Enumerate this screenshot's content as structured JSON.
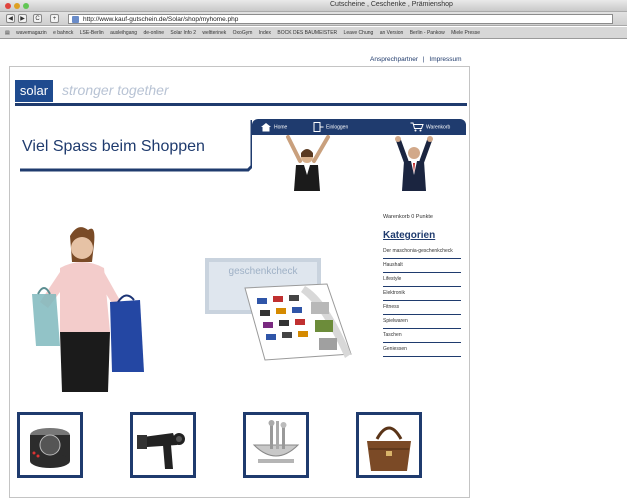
{
  "window": {
    "title": "Cutscheine , Ceschenke , Prämienshop"
  },
  "toolbar": {
    "back": "◀",
    "forward": "▶",
    "reload": "C",
    "add": "+",
    "url": "http://www.kauf-gutschein.de/Solar/shop/myhome.php"
  },
  "bookmarks": [
    "wavemagazin",
    "e bahnck",
    "LSE-Berlin",
    "ausleihgang",
    "de-online",
    "Solar Info 2",
    "weltterinek",
    "OxoGym",
    "Index",
    "BOCK DES BAUMEISTER",
    "Leave Chung",
    "an Version",
    "Berlin - Pankow",
    "Miele Presse"
  ],
  "header": {
    "links": {
      "contact": "Ansprechpartner",
      "separator": "|",
      "imprint": "Impressum"
    },
    "logo": "solar",
    "tagline": "stronger together"
  },
  "main": {
    "heading": "Viel Spass beim Shoppen"
  },
  "nav": {
    "home": "Home",
    "login": "Einloggen",
    "cart": "Warenkorb"
  },
  "sidebar": {
    "cart_info": "Warenkorb 0 Punkte",
    "categories_title": "Kategorien",
    "categories": [
      "Der maschonia-geschenkcheck",
      "Haushalt",
      "Lifestyle",
      "Elektronik",
      "Fitness",
      "Spielwaren",
      "Taschen",
      "Geniessen"
    ]
  },
  "voucher": {
    "title": "geschenkcheck"
  },
  "colors": {
    "brand": "#1f3b6e",
    "logo_bg": "#1f4b8f"
  }
}
